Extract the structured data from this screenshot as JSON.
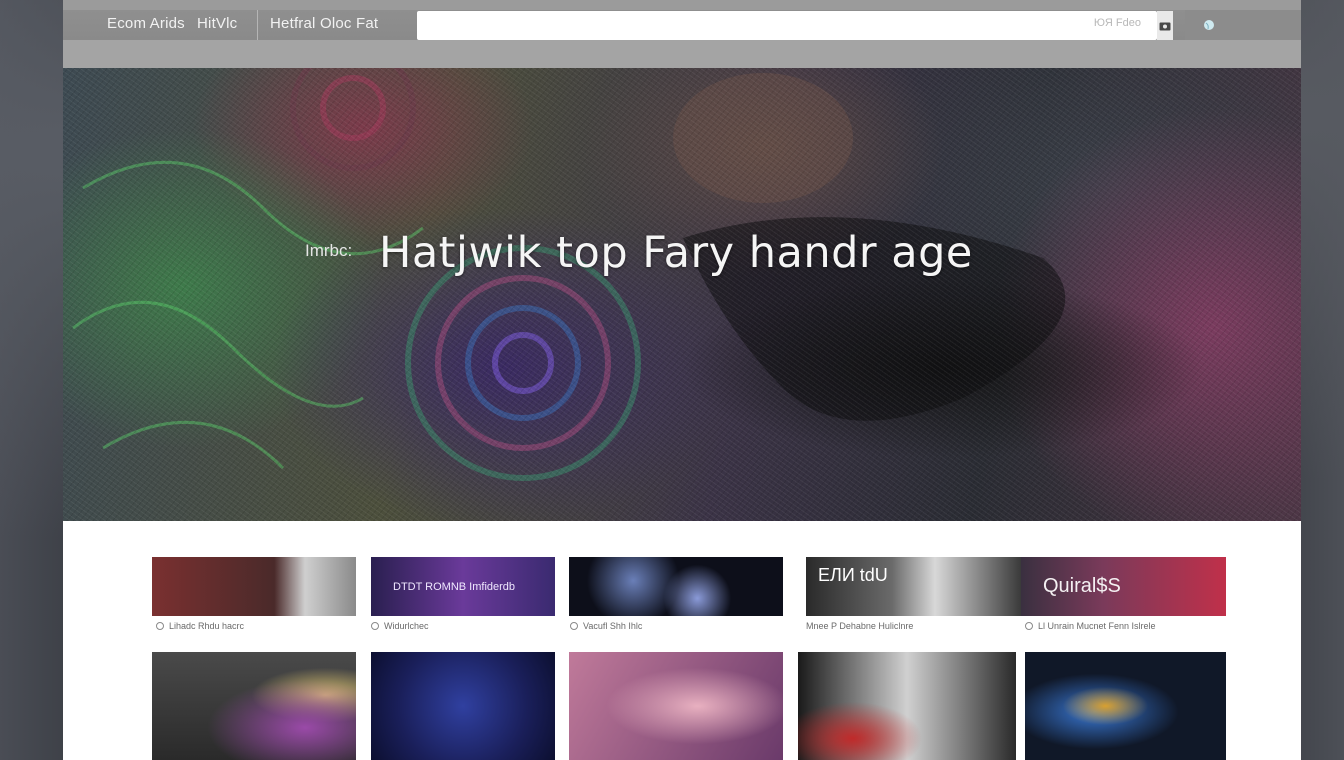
{
  "nav": {
    "item_1": "Ecom Arids",
    "item_2": "HitVlc",
    "item_3": "Hetfral Oloc Fat",
    "search_hint": "ЮЯ Fdeo"
  },
  "hero": {
    "kicker": "Imrbc:",
    "title": "Hatjwik top Fary handr age"
  },
  "gallery": {
    "row1": [
      {
        "overlay": "",
        "caption": "Lihadc Rhdu hacrc",
        "colors": [
          "#7a3030",
          "#3a2a2a",
          "#cfcfcf"
        ]
      },
      {
        "overlay": "DTDT ROMNB Imfiderdb",
        "caption": "Widurlchec",
        "colors": [
          "#5a3a8a",
          "#2a1f50",
          "#8a4ab0"
        ]
      },
      {
        "overlay": "",
        "caption": "Vacufl Shh Ihlc",
        "colors": [
          "#0d0f1a",
          "#6a7fb8",
          "#1c2440"
        ]
      },
      {
        "overlay": "ЕЛИ tdU",
        "caption": "Mnee P Dehabne Huliclnre",
        "colors": [
          "#2a2a2a",
          "#d8d8d8",
          "#555555"
        ]
      },
      {
        "overlay": "Quiral$S",
        "caption": "Ll Unrain Mucnet Fenn Islrele",
        "colors": [
          "#3a3040",
          "#c0304a",
          "#7a3a5a"
        ]
      }
    ],
    "row2": [
      {
        "colors": [
          "#3a3a3a",
          "#9a4aa8",
          "#d8c070"
        ]
      },
      {
        "colors": [
          "#1a1f5a",
          "#3040a0",
          "#8aa0e8"
        ]
      },
      {
        "colors": [
          "#c07a9a",
          "#e8b0c0",
          "#6a3a6a"
        ]
      },
      {
        "colors": [
          "#1a1a1a",
          "#c02a2a",
          "#d0d0d0"
        ]
      },
      {
        "colors": [
          "#101828",
          "#3a7ad8",
          "#d8a030"
        ]
      }
    ]
  }
}
